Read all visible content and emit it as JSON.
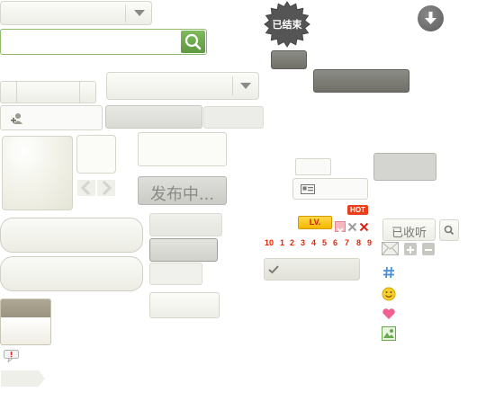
{
  "badges": {
    "ended": "已结束",
    "hot": "HOT",
    "level": "LV."
  },
  "buttons": {
    "publishing": "发布中...",
    "subscribed": "已收听"
  },
  "rank_numbers": [
    "10",
    "1",
    "2",
    "3",
    "4",
    "5",
    "6",
    "7",
    "8",
    "9"
  ],
  "icons": {
    "search": "search-icon",
    "download": "arrow-down-circle-icon",
    "dropdown": "chevron-down-icon",
    "add_user": "add-user-icon",
    "prev": "chevron-left-icon",
    "next": "chevron-right-icon",
    "vcard": "contact-card-icon",
    "close": "close-icon",
    "check": "check-icon",
    "mail": "envelope-icon",
    "plus": "plus-icon",
    "minus": "minus-icon",
    "hash": "hash-icon",
    "smiley": "smiley-icon",
    "heart": "heart-icon",
    "image": "image-icon",
    "alert": "alert-icon"
  },
  "colors": {
    "accent_green": "#6aa84f",
    "search_border": "#8fba6a",
    "dark_badge": "#555555",
    "hot_red": "#e8401c",
    "level_yellow": "#f5c400",
    "rank_red": "#ee2200",
    "hash_blue": "#4a90d9",
    "heart_pink": "#f06090"
  }
}
